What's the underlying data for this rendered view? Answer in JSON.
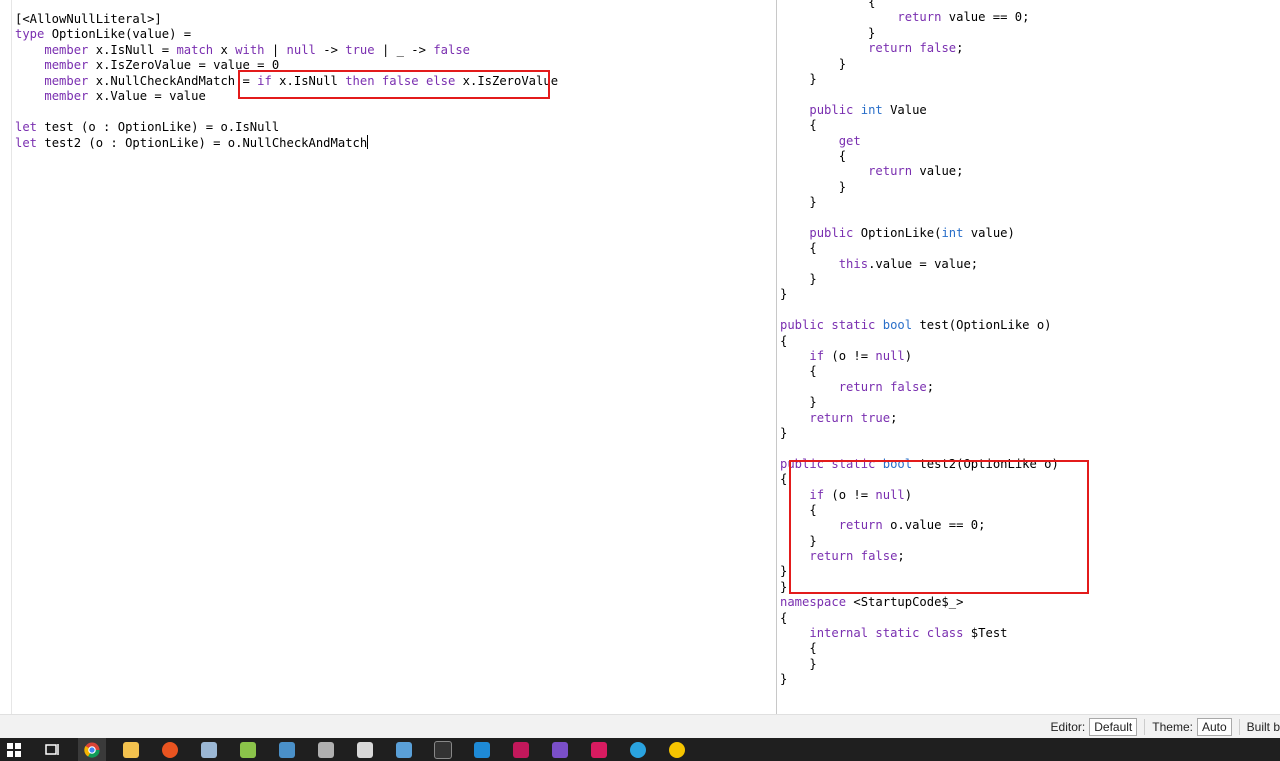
{
  "left_editor": {
    "lines": [
      [
        {
          "t": "[<AllowNullLiteral>]",
          "c": ""
        }
      ],
      [
        {
          "t": "type",
          "c": "kw"
        },
        {
          "t": " OptionLike(value) =",
          "c": ""
        }
      ],
      [
        {
          "t": "    ",
          "c": ""
        },
        {
          "t": "member",
          "c": "kw"
        },
        {
          "t": " x.IsNull = ",
          "c": ""
        },
        {
          "t": "match",
          "c": "kw"
        },
        {
          "t": " x ",
          "c": ""
        },
        {
          "t": "with",
          "c": "kw"
        },
        {
          "t": " | ",
          "c": ""
        },
        {
          "t": "null",
          "c": "kw"
        },
        {
          "t": " -> ",
          "c": ""
        },
        {
          "t": "true",
          "c": "kw"
        },
        {
          "t": " | _ -> ",
          "c": ""
        },
        {
          "t": "false",
          "c": "kw"
        }
      ],
      [
        {
          "t": "    ",
          "c": ""
        },
        {
          "t": "member",
          "c": "kw"
        },
        {
          "t": " x.IsZeroValue = value = 0",
          "c": ""
        }
      ],
      [
        {
          "t": "    ",
          "c": ""
        },
        {
          "t": "member",
          "c": "kw"
        },
        {
          "t": " x.NullCheckAndMatch = ",
          "c": ""
        },
        {
          "t": "if",
          "c": "kw"
        },
        {
          "t": " x.IsNull ",
          "c": ""
        },
        {
          "t": "then",
          "c": "kw"
        },
        {
          "t": " ",
          "c": ""
        },
        {
          "t": "false",
          "c": "kw"
        },
        {
          "t": " ",
          "c": ""
        },
        {
          "t": "else",
          "c": "kw"
        },
        {
          "t": " x.IsZeroValue",
          "c": ""
        }
      ],
      [
        {
          "t": "    ",
          "c": ""
        },
        {
          "t": "member",
          "c": "kw"
        },
        {
          "t": " x.Value = value",
          "c": ""
        }
      ],
      [],
      [
        {
          "t": "let",
          "c": "kw"
        },
        {
          "t": " test (o : OptionLike) = o.IsNull",
          "c": ""
        }
      ],
      [
        {
          "t": "let",
          "c": "kw"
        },
        {
          "t": " test2 (o : OptionLike) = o.NullCheckAndMatch",
          "c": ""
        }
      ]
    ]
  },
  "right_editor": {
    "lines": [
      [
        {
          "t": "            ",
          "c": ""
        },
        {
          "t": "{",
          "c": ""
        }
      ],
      [
        {
          "t": "                ",
          "c": ""
        },
        {
          "t": "return",
          "c": "kw"
        },
        {
          "t": " value == 0;",
          "c": ""
        }
      ],
      [
        {
          "t": "            }",
          "c": ""
        }
      ],
      [
        {
          "t": "            ",
          "c": ""
        },
        {
          "t": "return",
          "c": "kw"
        },
        {
          "t": " ",
          "c": ""
        },
        {
          "t": "false",
          "c": "kw"
        },
        {
          "t": ";",
          "c": ""
        }
      ],
      [
        {
          "t": "        }",
          "c": ""
        }
      ],
      [
        {
          "t": "    }",
          "c": ""
        }
      ],
      [],
      [
        {
          "t": "    ",
          "c": ""
        },
        {
          "t": "public",
          "c": "kw"
        },
        {
          "t": " ",
          "c": ""
        },
        {
          "t": "int",
          "c": "bl"
        },
        {
          "t": " Value",
          "c": ""
        }
      ],
      [
        {
          "t": "    {",
          "c": ""
        }
      ],
      [
        {
          "t": "        ",
          "c": ""
        },
        {
          "t": "get",
          "c": "kw"
        }
      ],
      [
        {
          "t": "        {",
          "c": ""
        }
      ],
      [
        {
          "t": "            ",
          "c": ""
        },
        {
          "t": "return",
          "c": "kw"
        },
        {
          "t": " value;",
          "c": ""
        }
      ],
      [
        {
          "t": "        }",
          "c": ""
        }
      ],
      [
        {
          "t": "    }",
          "c": ""
        }
      ],
      [],
      [
        {
          "t": "    ",
          "c": ""
        },
        {
          "t": "public",
          "c": "kw"
        },
        {
          "t": " OptionLike(",
          "c": ""
        },
        {
          "t": "int",
          "c": "bl"
        },
        {
          "t": " value)",
          "c": ""
        }
      ],
      [
        {
          "t": "    {",
          "c": ""
        }
      ],
      [
        {
          "t": "        ",
          "c": ""
        },
        {
          "t": "this",
          "c": "kw"
        },
        {
          "t": ".value = value;",
          "c": ""
        }
      ],
      [
        {
          "t": "    }",
          "c": ""
        }
      ],
      [
        {
          "t": "}",
          "c": ""
        }
      ],
      [],
      [
        {
          "t": "public",
          "c": "kw"
        },
        {
          "t": " ",
          "c": ""
        },
        {
          "t": "static",
          "c": "kw"
        },
        {
          "t": " ",
          "c": ""
        },
        {
          "t": "bool",
          "c": "bl"
        },
        {
          "t": " test(OptionLike o)",
          "c": ""
        }
      ],
      [
        {
          "t": "{",
          "c": ""
        }
      ],
      [
        {
          "t": "    ",
          "c": ""
        },
        {
          "t": "if",
          "c": "kw"
        },
        {
          "t": " (o != ",
          "c": ""
        },
        {
          "t": "null",
          "c": "kw"
        },
        {
          "t": ")",
          "c": ""
        }
      ],
      [
        {
          "t": "    {",
          "c": ""
        }
      ],
      [
        {
          "t": "        ",
          "c": ""
        },
        {
          "t": "return",
          "c": "kw"
        },
        {
          "t": " ",
          "c": ""
        },
        {
          "t": "false",
          "c": "kw"
        },
        {
          "t": ";",
          "c": ""
        }
      ],
      [
        {
          "t": "    }",
          "c": ""
        }
      ],
      [
        {
          "t": "    ",
          "c": ""
        },
        {
          "t": "return",
          "c": "kw"
        },
        {
          "t": " ",
          "c": ""
        },
        {
          "t": "true",
          "c": "kw"
        },
        {
          "t": ";",
          "c": ""
        }
      ],
      [
        {
          "t": "}",
          "c": ""
        }
      ],
      [],
      [
        {
          "t": "public",
          "c": "kw"
        },
        {
          "t": " ",
          "c": ""
        },
        {
          "t": "static",
          "c": "kw"
        },
        {
          "t": " ",
          "c": ""
        },
        {
          "t": "bool",
          "c": "bl"
        },
        {
          "t": " test2(OptionLike o)",
          "c": ""
        }
      ],
      [
        {
          "t": "{",
          "c": ""
        }
      ],
      [
        {
          "t": "    ",
          "c": ""
        },
        {
          "t": "if",
          "c": "kw"
        },
        {
          "t": " (o != ",
          "c": ""
        },
        {
          "t": "null",
          "c": "kw"
        },
        {
          "t": ")",
          "c": ""
        }
      ],
      [
        {
          "t": "    {",
          "c": ""
        }
      ],
      [
        {
          "t": "        ",
          "c": ""
        },
        {
          "t": "return",
          "c": "kw"
        },
        {
          "t": " o.value == 0;",
          "c": ""
        }
      ],
      [
        {
          "t": "    }",
          "c": ""
        }
      ],
      [
        {
          "t": "    ",
          "c": ""
        },
        {
          "t": "return",
          "c": "kw"
        },
        {
          "t": " ",
          "c": ""
        },
        {
          "t": "false",
          "c": "kw"
        },
        {
          "t": ";",
          "c": ""
        }
      ],
      [
        {
          "t": "}",
          "c": ""
        }
      ],
      [
        {
          "t": "}",
          "c": ""
        }
      ],
      [
        {
          "t": "namespace",
          "c": "kw"
        },
        {
          "t": " <StartupCode$_>",
          "c": ""
        }
      ],
      [
        {
          "t": "{",
          "c": ""
        }
      ],
      [
        {
          "t": "    ",
          "c": ""
        },
        {
          "t": "internal",
          "c": "kw"
        },
        {
          "t": " ",
          "c": ""
        },
        {
          "t": "static",
          "c": "kw"
        },
        {
          "t": " ",
          "c": ""
        },
        {
          "t": "class",
          "c": "kw"
        },
        {
          "t": " $Test",
          "c": ""
        }
      ],
      [
        {
          "t": "    {",
          "c": ""
        }
      ],
      [
        {
          "t": "    }",
          "c": ""
        }
      ],
      [
        {
          "t": "}",
          "c": ""
        }
      ]
    ]
  },
  "status": {
    "editor_label": "Editor:",
    "editor_value": "Default",
    "theme_label": "Theme:",
    "theme_value": "Auto",
    "built_label": "Built b"
  },
  "taskbar": {
    "icons": [
      "windows-start-icon",
      "task-view-icon",
      "chrome-icon",
      "file-explorer-icon",
      "ubuntu-icon",
      "remote-desktop-icon",
      "notepad-plus-icon",
      "calculator-icon",
      "cube-app-icon",
      "performance-monitor-icon",
      "pen-icon",
      "terminal-icon",
      "vscode-icon",
      "rider-icon",
      "visual-studio-icon",
      "rider-alt-icon",
      "telegram-icon",
      "outlook-icon"
    ]
  },
  "colors": {
    "keyword": "#7a2fb0",
    "type_keyword": "#2a6fc9",
    "highlight_box": "#e31b1b",
    "taskbar": "#1f1f1f"
  }
}
